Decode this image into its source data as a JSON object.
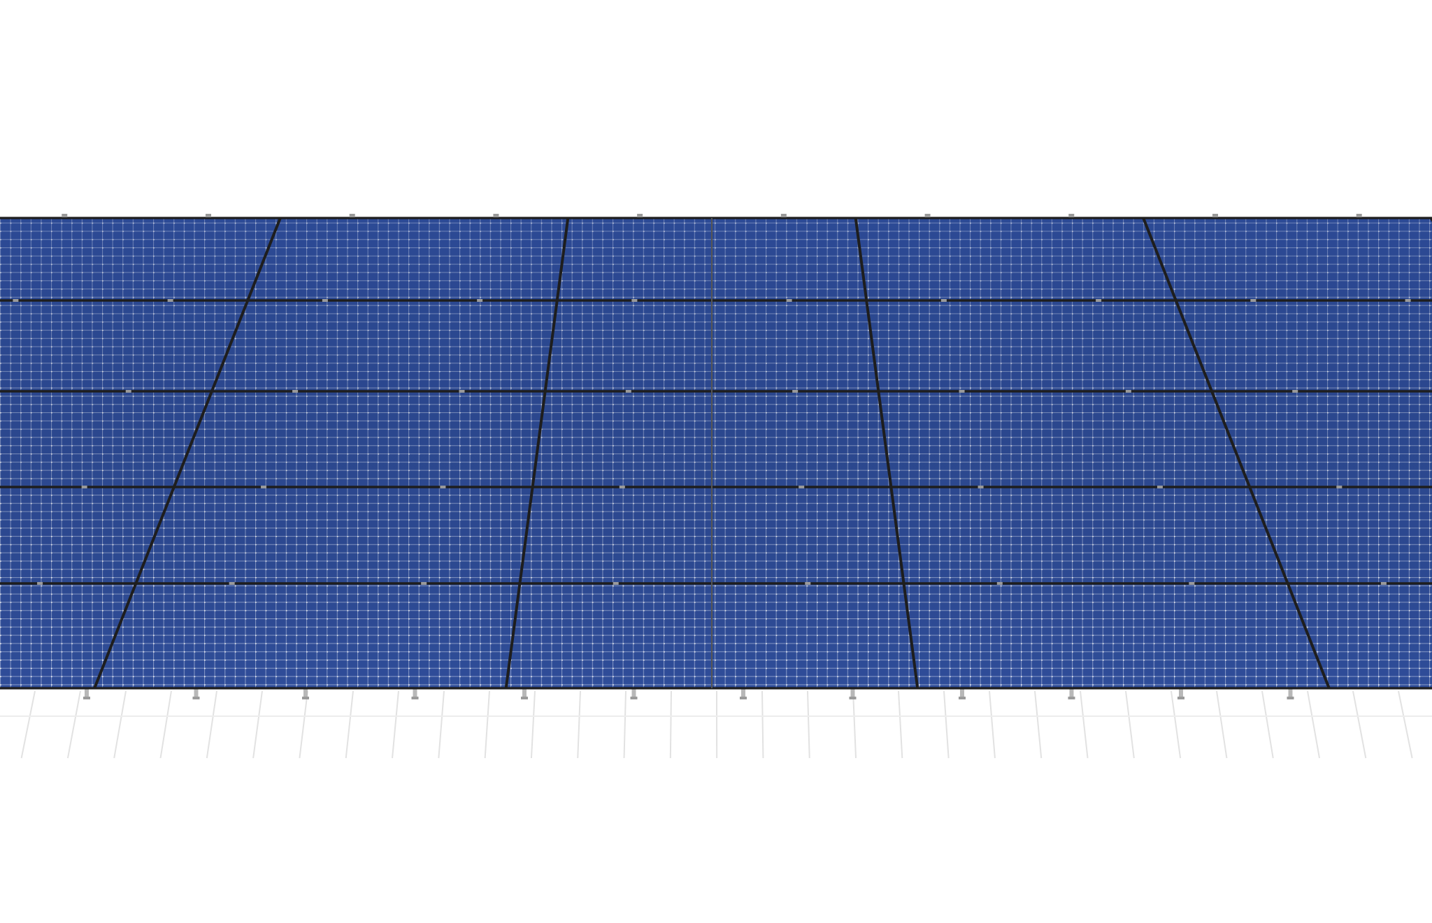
{
  "scene": {
    "subject": "solar-panel-array",
    "rows": 5,
    "modules_per_row": 7,
    "cell_columns_per_module": 20,
    "cell_rows_per_module": 10,
    "colors": {
      "background": "#ffffff",
      "cell_blue": "#2f4d99",
      "cell_blue_dark": "#23408a",
      "grid_line": "#c4cde6",
      "frame": "#1e1e1e",
      "clamp": "#9a9a9a",
      "leg": "#b8b8b8",
      "shadow_line": "#e2e2e2"
    }
  }
}
